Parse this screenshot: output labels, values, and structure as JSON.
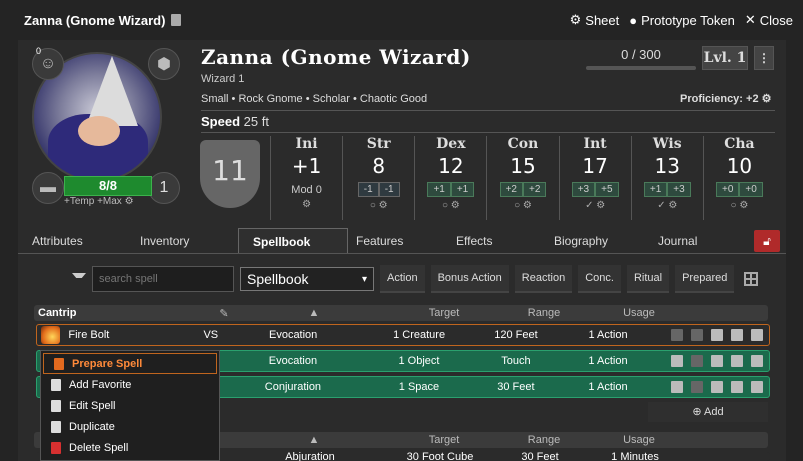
{
  "window": {
    "title": "Zanna (Gnome Wizard)",
    "sheet_label": "Sheet",
    "prototype_label": "Prototype Token",
    "close_label": "Close"
  },
  "header": {
    "name": "Zanna (Gnome Wizard)",
    "class": "Wizard 1",
    "description": "Small • Rock Gnome • Scholar • Chaotic Good",
    "xp": "0 / 300",
    "level": "Lvl. 1",
    "proficiency": "Proficiency: +2",
    "speed_label": "Speed",
    "speed_value": "25 ft",
    "ac": "11",
    "hp": "8/8",
    "hp_temp": "+Temp  +Max",
    "inspiration": "0",
    "hit_dice": "1"
  },
  "stats": [
    {
      "label": "Ini",
      "value": "+1",
      "extra": "Mod  0"
    },
    {
      "label": "Str",
      "value": "8",
      "mods": [
        "-1",
        "-1"
      ],
      "pos": false
    },
    {
      "label": "Dex",
      "value": "12",
      "mods": [
        "+1",
        "+1"
      ],
      "pos": true
    },
    {
      "label": "Con",
      "value": "15",
      "mods": [
        "+2",
        "+2"
      ],
      "pos": true
    },
    {
      "label": "Int",
      "value": "17",
      "mods": [
        "+3",
        "+5"
      ],
      "pos": true
    },
    {
      "label": "Wis",
      "value": "13",
      "mods": [
        "+1",
        "+3"
      ],
      "pos": true
    },
    {
      "label": "Cha",
      "value": "10",
      "mods": [
        "+0",
        "+0"
      ],
      "pos": true
    }
  ],
  "tabs": [
    "Attributes",
    "Inventory",
    "Spellbook",
    "Features",
    "Effects",
    "Biography",
    "Journal"
  ],
  "filter": {
    "search_placeholder": "search spell",
    "select_value": "Spellbook",
    "tabs": [
      "Action",
      "Bonus Action",
      "Reaction",
      "Conc.",
      "Ritual",
      "Prepared"
    ]
  },
  "table": {
    "section1": "Cantrip",
    "section2": "",
    "cols": [
      "Target",
      "Range",
      "Usage"
    ],
    "rows": [
      {
        "name": "Fire Bolt",
        "comp": "VS",
        "school": "Evocation",
        "target": "1 Creature",
        "range": "120 Feet",
        "usage": "1 Action"
      },
      {
        "name": "",
        "comp": "",
        "school": "Evocation",
        "target": "1 Object",
        "range": "Touch",
        "usage": "1 Action"
      },
      {
        "name": "",
        "comp": "",
        "school": "Conjuration",
        "target": "1 Space",
        "range": "30 Feet",
        "usage": "1 Action"
      }
    ],
    "add_label": "Add",
    "partial_row": {
      "school": "Abjuration",
      "target": "30 Foot Cube",
      "range": "30 Feet",
      "usage": "1 Minutes"
    }
  },
  "context_menu": [
    "Prepare Spell",
    "Add Favorite",
    "Edit Spell",
    "Duplicate",
    "Delete Spell"
  ],
  "colors": {
    "accent": "#c0651e",
    "prepared": "#1b6a4c",
    "hp": "#1e8a2e",
    "lock": "#b02a2a"
  }
}
